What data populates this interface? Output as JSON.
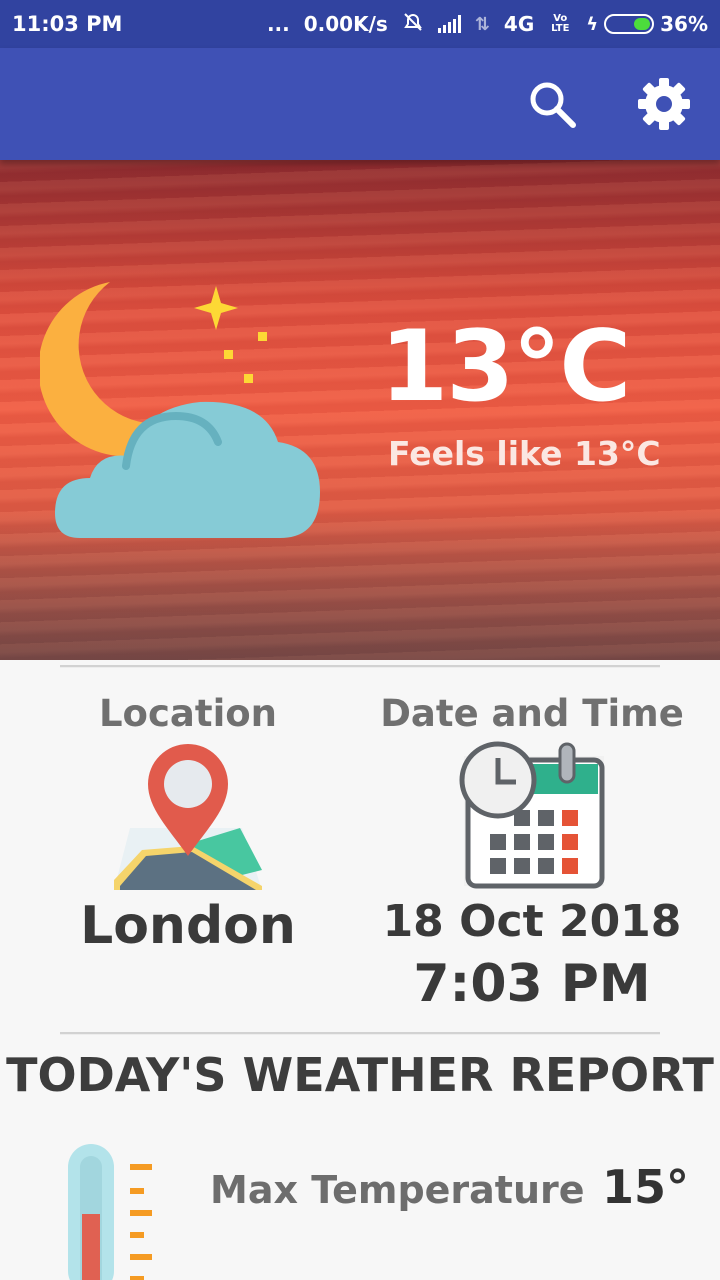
{
  "status_bar": {
    "time": "11:03 PM",
    "dots": "...",
    "speed": "0.00K/s",
    "network": "4G",
    "volte": "Vo LTE",
    "battery": "36%",
    "battery_level": 0.36
  },
  "app_bar": {
    "search_icon": "search-icon",
    "settings_icon": "gear-icon"
  },
  "current": {
    "temperature": "13°C",
    "feels_like": "Feels like 13°C",
    "condition_icon": "moon-cloud-icon"
  },
  "location": {
    "label": "Location",
    "city": "London",
    "icon": "map-pin-icon"
  },
  "datetime": {
    "label": "Date and Time",
    "date": "18 Oct 2018",
    "time": "7:03 PM",
    "icon": "calendar-clock-icon"
  },
  "report": {
    "title": "TODAY'S WEATHER REPORT",
    "max_label": "Max Temperature",
    "max_value": "15°",
    "icon": "thermometer-icon"
  }
}
